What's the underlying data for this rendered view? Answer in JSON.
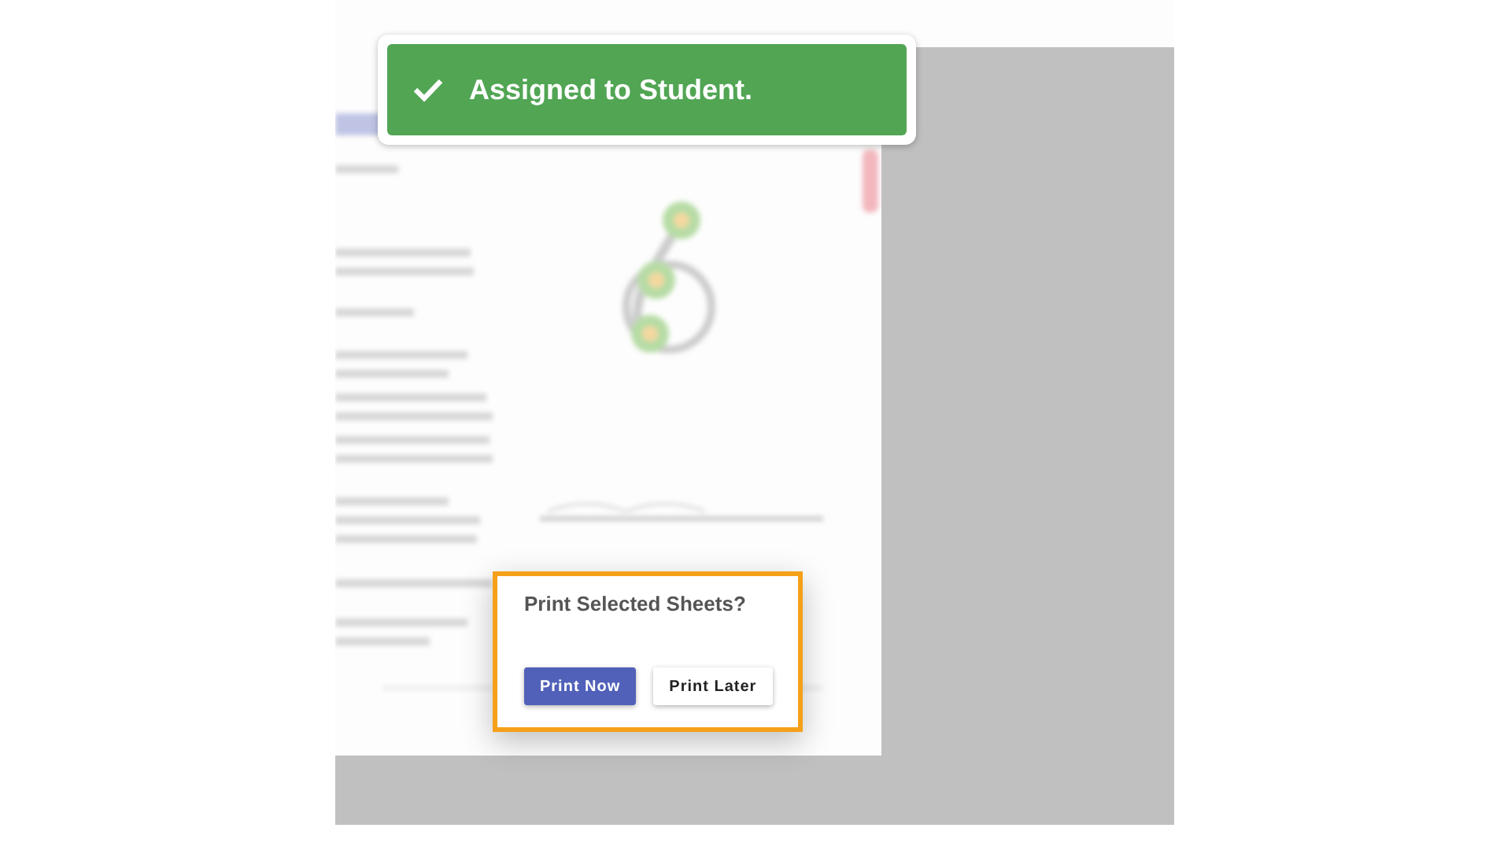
{
  "toast": {
    "message": "Assigned to Student."
  },
  "dialog": {
    "title": "Print Selected Sheets?",
    "buttons": [
      {
        "label": "Print Now",
        "kind": "primary"
      },
      {
        "label": "Print Later",
        "kind": "secondary"
      }
    ]
  }
}
